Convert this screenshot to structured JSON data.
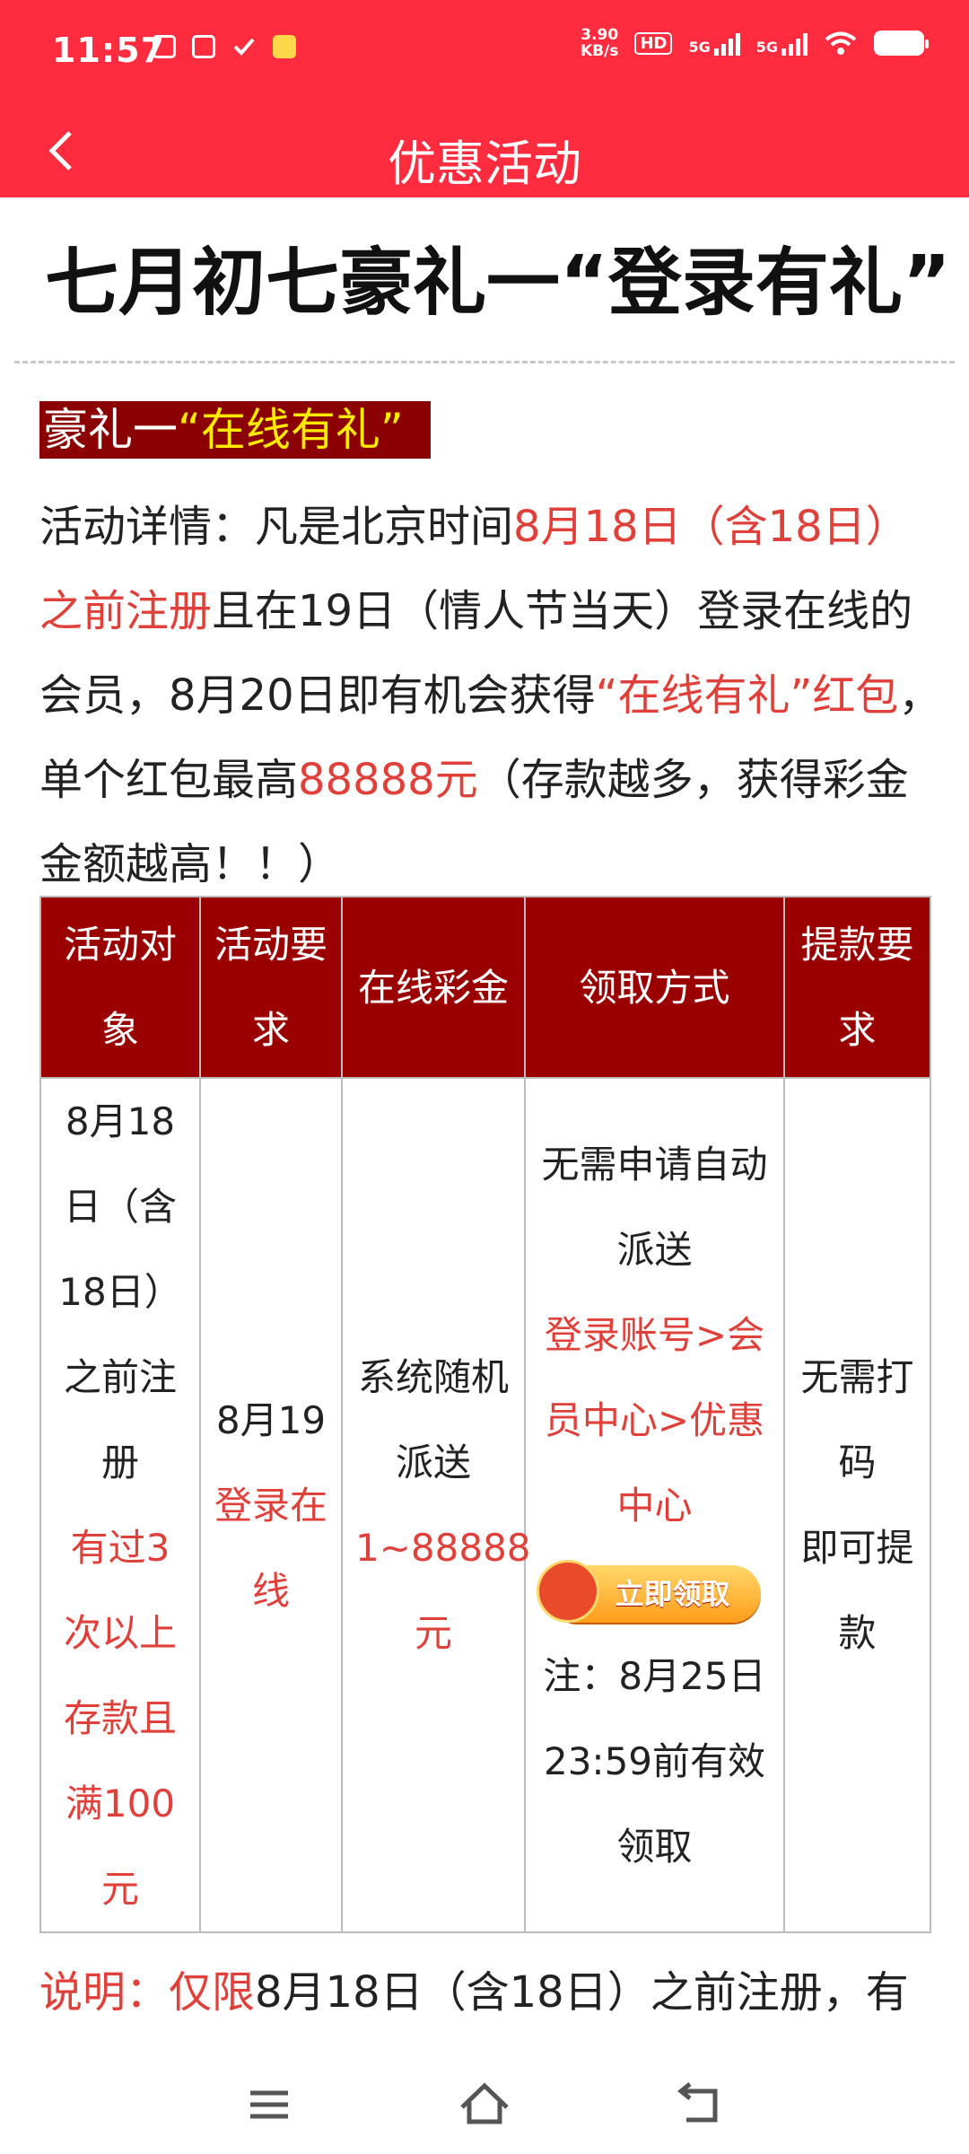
{
  "status_bar": {
    "time": "11:57",
    "net_speed_value": "3.90",
    "net_speed_unit": "KB/s",
    "hd_label": "HD",
    "signal1_label": "5G",
    "signal2_label": "5G",
    "icons": [
      "check-shield-icon",
      "app-square-icon",
      "check-mark-icon",
      "yellow-app-icon",
      "wifi-icon",
      "battery-icon"
    ]
  },
  "header": {
    "title": "优惠活动",
    "bg_color": "#ff2b3f"
  },
  "article": {
    "headline": "七月初七豪礼一“登录有礼”",
    "section_prefix": "豪礼一",
    "section_highlight": "“在线有礼”",
    "detail": {
      "p1": "活动详情：凡是北京时间",
      "p2_red": "8月18日（含18日）之前注册",
      "p3": "且在19日（情人节当天）登录在线的会员，8月20日即有机会获得",
      "p4_red": "“在线有礼”红包",
      "p5": "，单个红包最高",
      "p6_red": "88888元",
      "p7": "（存款越多，获得彩金金额越高！！）"
    },
    "table": {
      "headers": [
        "活动对象",
        "活动要求",
        "在线彩金",
        "领取方式",
        "提款要求"
      ],
      "row": {
        "target_black": "8月18日（含18日）之前注册",
        "target_red": "有过3次以上存款且满100元",
        "req_black": "8月19",
        "req_red": "登录在线",
        "bonus_black": "系统随机派送",
        "bonus_red": "1~88888元",
        "method_black": "无需申请自动派送",
        "method_red": "登录账号>会员中心>优惠中心",
        "claim_button": "立即领取",
        "method_note": "注：8月25日23:59前有效领取",
        "withdraw_1": "无需打码",
        "withdraw_2": "即可提款"
      }
    },
    "note_red": "说明：仅限",
    "note_black": "8月18日（含18日）之前注册，有"
  },
  "colors": {
    "accent_red": "#e0403a",
    "table_header": "#9a0000",
    "section_bg": "#8b0000",
    "highlight_yellow": "#ffea00"
  }
}
